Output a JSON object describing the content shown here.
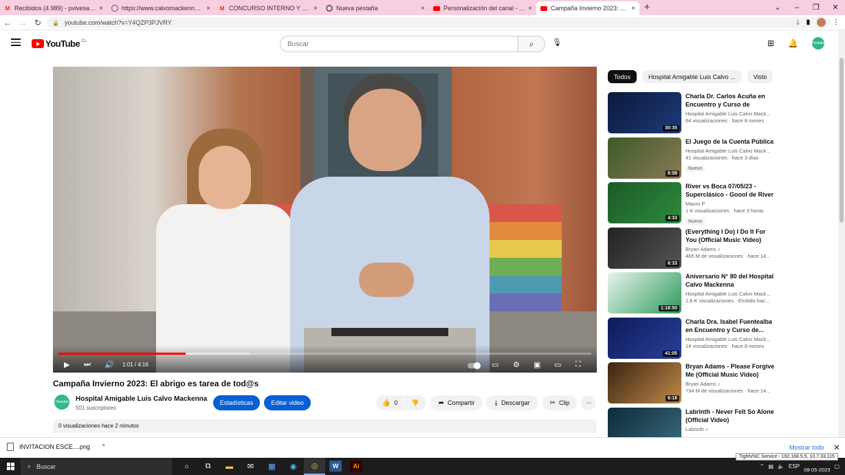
{
  "browser": {
    "tabs": [
      {
        "title": "Recibidos (4.989) - pvivesa@gmail.com",
        "icon": "gmail-icon",
        "active": false
      },
      {
        "title": "https://www.calvomackenna.cl/",
        "icon": "globe-icon",
        "active": false
      },
      {
        "title": "CONCURSO INTERNO Y EXTERNO",
        "icon": "gmail-icon",
        "active": false
      },
      {
        "title": "Nueva pestaña",
        "icon": "chrome-icon",
        "active": false
      },
      {
        "title": "Personalización del canal - YouTube",
        "icon": "youtube-icon",
        "active": false
      },
      {
        "title": "Campaña Invierno 2023: El abrigo",
        "icon": "youtube-icon",
        "active": true
      }
    ],
    "url": "youtube.com/watch?v=Y4QZP3PJVRY"
  },
  "masthead": {
    "logo_text": "YouTube",
    "country_code": "CL",
    "search_placeholder": "Buscar",
    "avatar_text": "Hospital"
  },
  "player": {
    "time_current": "1:01",
    "time_total": "4:16",
    "progress_fraction": 0.2383,
    "buffer_fraction": 0.36
  },
  "video": {
    "title": "Campaña Invierno 2023: El abrigo es tarea de tod@s",
    "channel_name": "Hospital Amigable Luis Calvo Mackenna",
    "subscribers": "501 suscriptores",
    "channel_avatar_text": "Hospital",
    "stats_button": "Estadísticas",
    "edit_button": "Editar video",
    "likes": "0",
    "share_label": "Compartir",
    "download_label": "Descargar",
    "clip_label": "Clip",
    "views_line": "0 visualizaciones  hace 2 minutos"
  },
  "chips": [
    "Todos",
    "Hospital Amigable Luis Calvo ...",
    "Visto"
  ],
  "recommendations": [
    {
      "title": "Charla Dr. Carlos Acuña en Encuentro y Curso de Médicos...",
      "channel": "Hospital Amigable Luis Calvo Mack...",
      "meta": "64 visualizaciones · hace 8 meses",
      "duration": "30:35",
      "badge": ""
    },
    {
      "title": "El Juego de la Cuenta Pública",
      "channel": "Hospital Amigable Luis Calvo Mack...",
      "meta": "41 visualizaciones · hace 3 días",
      "duration": "8:08",
      "badge": "Nuevo"
    },
    {
      "title": "River vs Boca 07/05/23 - Superclásico - Goool de River -...",
      "channel": "Mauro P",
      "meta": "1 K visualizaciones · hace 3 horas",
      "duration": "4:33",
      "badge": "Nuevo"
    },
    {
      "title": "(Everything I Do) I Do It For You (Official Music Video)",
      "channel": "Bryan Adams ♪",
      "meta": "465 M de visualizaciones · hace 14...",
      "duration": "6:33",
      "badge": ""
    },
    {
      "title": "Aniversario N° 80 del Hospital Calvo Mackenna",
      "channel": "Hospital Amigable Luis Calvo Mack...",
      "meta": "1,6 K visualizaciones · Emitido hac...",
      "duration": "1:18:50",
      "badge": ""
    },
    {
      "title": "Charla Dra. Isabel Fuentealba en Encuentro y Curso de...",
      "channel": "Hospital Amigable Luis Calvo Mack...",
      "meta": "14 visualizaciones · hace 8 meses",
      "duration": "41:05",
      "badge": ""
    },
    {
      "title": "Bryan Adams - Please Forgive Me (Official Music Video)",
      "channel": "Bryan Adams ♪",
      "meta": "734 M de visualizaciones · hace 14...",
      "duration": "6:18",
      "badge": ""
    },
    {
      "title": "Labrinth - Never Felt So Alone (Official Video)",
      "channel": "Labrinth ♪",
      "meta": "",
      "duration": "",
      "badge": ""
    }
  ],
  "download": {
    "filename": "INVITACION ESCE....png",
    "show_all": "Mostrar todo"
  },
  "taskbar": {
    "search": "Buscar",
    "lang": "ESP",
    "date": "08-05-2023",
    "tooltip": "TightVNC Service - 192.168.5.5, 10.7.33.115"
  },
  "colors": {
    "accent": "#065fd4",
    "brand": "#ff0000",
    "tabstrip": "#f7cfe0"
  }
}
